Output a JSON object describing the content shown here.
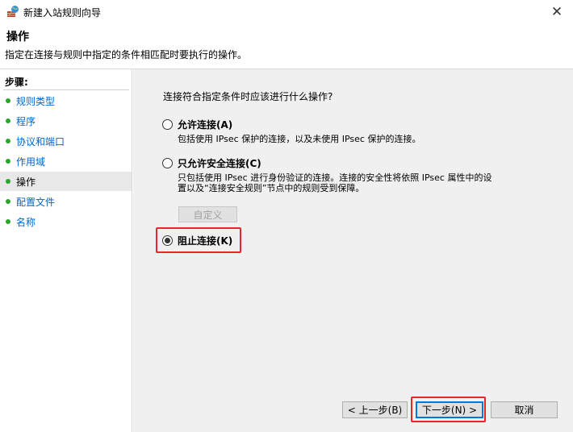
{
  "window": {
    "title": "新建入站规则向导",
    "close_glyph": "✕"
  },
  "header": {
    "title": "操作",
    "description": "指定在连接与规则中指定的条件相匹配时要执行的操作。"
  },
  "sidebar": {
    "steps_label": "步骤:",
    "items": [
      {
        "label": "规则类型",
        "active": false
      },
      {
        "label": "程序",
        "active": false
      },
      {
        "label": "协议和端口",
        "active": false
      },
      {
        "label": "作用域",
        "active": false
      },
      {
        "label": "操作",
        "active": true
      },
      {
        "label": "配置文件",
        "active": false
      },
      {
        "label": "名称",
        "active": false
      }
    ],
    "bullet_color": "#2aa52a"
  },
  "main": {
    "question": "连接符合指定条件时应该进行什么操作?",
    "options": [
      {
        "label": "允许连接(A)",
        "description": "包括使用 IPsec 保护的连接，以及未使用 IPsec 保护的连接。",
        "selected": false
      },
      {
        "label": "只允许安全连接(C)",
        "description_line1": "只包括使用 IPsec 进行身份验证的连接。连接的安全性将依照 IPsec 属性中的设",
        "description_line2": "置以及“连接安全规则”节点中的规则受到保障。",
        "selected": false
      },
      {
        "label": "阻止连接(K)",
        "selected": true
      }
    ],
    "customize_label": "自定义"
  },
  "footer": {
    "back_label": "< 上一步(B)",
    "next_label": "下一步(N) >",
    "cancel_label": "取消"
  },
  "colors": {
    "highlight": "#e8262a",
    "focus": "#0078d7",
    "link": "#0066cc"
  }
}
